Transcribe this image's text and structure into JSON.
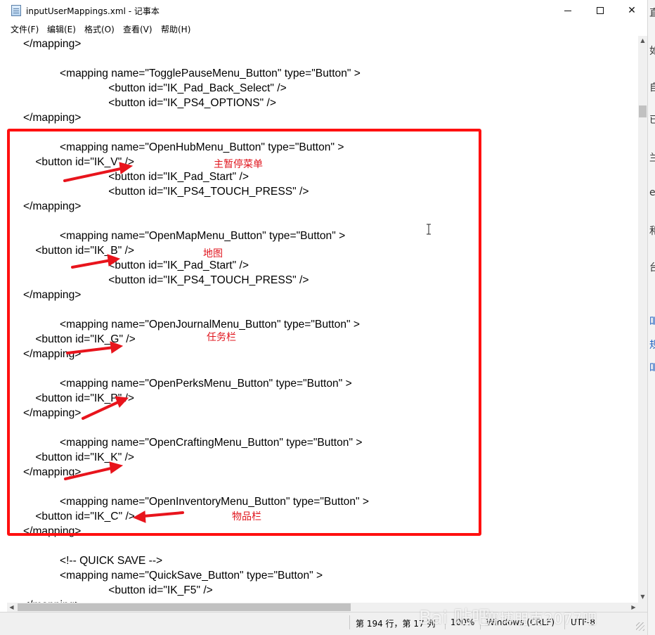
{
  "window": {
    "title": "inputUserMappings.xml - 记事本",
    "minimize": "minimize",
    "maximize": "maximize",
    "close": "✕"
  },
  "menu": [
    "文件(F)",
    "编辑(E)",
    "格式(O)",
    "查看(V)",
    "帮助(H)"
  ],
  "lines": [
    "</mapping>",
    "",
    "            <mapping name=\"TogglePauseMenu_Button\" type=\"Button\" >",
    "                            <button id=\"IK_Pad_Back_Select\" />",
    "                            <button id=\"IK_PS4_OPTIONS\" />",
    "</mapping>",
    "",
    "            <mapping name=\"OpenHubMenu_Button\" type=\"Button\" >",
    "    <button id=\"IK_V\" />",
    "                            <button id=\"IK_Pad_Start\" />",
    "                            <button id=\"IK_PS4_TOUCH_PRESS\" />",
    "</mapping>",
    "",
    "            <mapping name=\"OpenMapMenu_Button\" type=\"Button\" >",
    "    <button id=\"IK_B\" />",
    "                            <button id=\"IK_Pad_Start\" />",
    "                            <button id=\"IK_PS4_TOUCH_PRESS\" />",
    "</mapping>",
    "",
    "            <mapping name=\"OpenJournalMenu_Button\" type=\"Button\" >",
    "    <button id=\"IK_G\" />",
    "</mapping>",
    "",
    "            <mapping name=\"OpenPerksMenu_Button\" type=\"Button\" >",
    "    <button id=\"IK_P\" />",
    "</mapping>",
    "",
    "            <mapping name=\"OpenCraftingMenu_Button\" type=\"Button\" >",
    "    <button id=\"IK_K\" />",
    "</mapping>",
    "",
    "            <mapping name=\"OpenInventoryMenu_Button\" type=\"Button\" >",
    "    <button id=\"IK_C\" />",
    "</mapping>",
    "",
    "            <!-- QUICK SAVE -->",
    "            <mapping name=\"QuickSave_Button\" type=\"Button\" >",
    "                            <button id=\"IK_F5\" />",
    "</mapping>"
  ],
  "annotations": {
    "hub": "主暂停菜单",
    "map": "地图",
    "journal": "任务栏",
    "inventory": "物品栏",
    "box_color": "#ff1010",
    "text_color": "#e0151d"
  },
  "statusbar": {
    "position": "第 194 行，第 17 列",
    "zoom": "100%",
    "line_ending": "Windows (CRLF)",
    "encoding": "UTF-8"
  },
  "watermark": {
    "logo": "Bai 贴吧",
    "text": "赛博朋克2077吧"
  },
  "background_fragments": [
    "直",
    "如",
    "自",
    "已",
    "兰",
    "e",
    "和",
    "台",
    "吅",
    "规",
    "吅"
  ]
}
